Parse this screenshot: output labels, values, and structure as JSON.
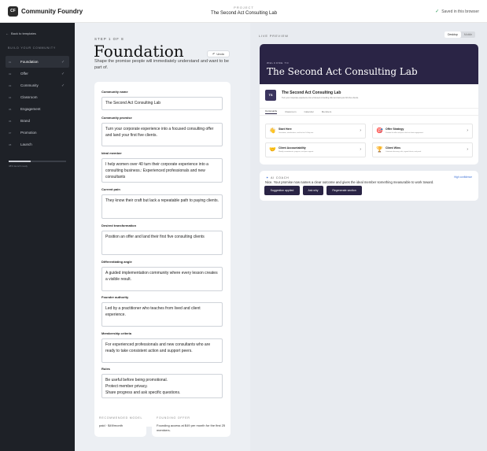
{
  "topbar": {
    "logo_initials": "CF",
    "app_name": "Community Foundry",
    "project_label": "PROJECT",
    "project_name": "The Second Act Consulting Lab",
    "saved_text": "Saved in this browser"
  },
  "sidebar": {
    "back_label": "Back to templates",
    "section_label": "BUILD YOUR COMMUNITY",
    "steps": [
      {
        "num": "01",
        "label": "Foundation",
        "done": true
      },
      {
        "num": "02",
        "label": "Offer",
        "done": true
      },
      {
        "num": "03",
        "label": "Community",
        "done": true
      },
      {
        "num": "04",
        "label": "Classroom",
        "done": false
      },
      {
        "num": "05",
        "label": "Engagement",
        "done": false
      },
      {
        "num": "06",
        "label": "Brand",
        "done": false
      },
      {
        "num": "07",
        "label": "Promotion",
        "done": false
      },
      {
        "num": "08",
        "label": "Launch",
        "done": false
      }
    ],
    "progress": 0.38,
    "progress_text": "38% launch ready"
  },
  "editor": {
    "kicker": "STEP 1 OF 8",
    "title": "Foundation",
    "subtitle": "Shape the promise people will immediately understand and want to be part of.",
    "undo_label": "Undo",
    "fields": [
      {
        "label": "Community name",
        "value": "The Second Act Consulting Lab"
      },
      {
        "label": "Community promise",
        "value": "Turn your corporate experience into a focused consulting offer and land your first five clients."
      },
      {
        "label": "Ideal member",
        "value": "I help women over 40 turn their corporate experience into a consulting business.: Experienced professionals and new consultants"
      },
      {
        "label": "Current pain",
        "value": "They know their craft but lack a repeatable path to paying clients."
      },
      {
        "label": "Desired transformation",
        "value": "Position an offer and land their first five consulting clients"
      },
      {
        "label": "Differentiating angle",
        "value": "A guided implementation community where every lesson creates a visible result."
      },
      {
        "label": "Founder authority",
        "value": "Led by a practitioner who teaches from lived and client experience."
      },
      {
        "label": "Membership criteria",
        "value": "For experienced professionals and new consultants who are ready to take consistent action and support peers."
      },
      {
        "label": "Rules",
        "value": "Be useful before being promotional.\nProtect member privacy.\nShare progress and ask specific questions."
      }
    ],
    "recommended": {
      "kicker": "RECOMMENDED MODEL",
      "text": "paid · $49/month"
    },
    "founding": {
      "kicker": "FOUNDING OFFER",
      "text": "Founding access at $49 per month for the first 25 members."
    }
  },
  "preview": {
    "label": "LIVE PREVIEW",
    "toggle": [
      "Desktop",
      "Mobile"
    ],
    "welcome": "WELCOME TO",
    "hero_title": "The Second Act Consulting Lab",
    "badge": "TS",
    "name": "The Second Act Consulting Lab",
    "promise": "Turn your corporate experience into a focused consulting offer and land your first five clients.",
    "tabs": [
      "Community",
      "Classroom",
      "Calendar",
      "Members"
    ],
    "cards": [
      {
        "icon": "👋",
        "title": "Start Here",
        "sub": "Orientation, introductions, and the first 14-day win."
      },
      {
        "icon": "🎯",
        "title": "Offer Strategy",
        "sub": "Position the offer and price the first client engagement."
      },
      {
        "icon": "🤝",
        "title": "Client Accountability",
        "sub": "Weekly commitments, progress, and peer support."
      },
      {
        "icon": "🏆",
        "title": "Client Wins",
        "sub": "Celebrate discovery calls, signed clients, and proof."
      }
    ],
    "coach": {
      "kicker": "AI COACH",
      "confidence": "High confidence",
      "text": "Nice. Your promise now names a clear outcome and gives the ideal member something measurable to work toward.",
      "buttons": [
        "Suggestion applied",
        "Ask why",
        "Regenerate section"
      ]
    }
  }
}
